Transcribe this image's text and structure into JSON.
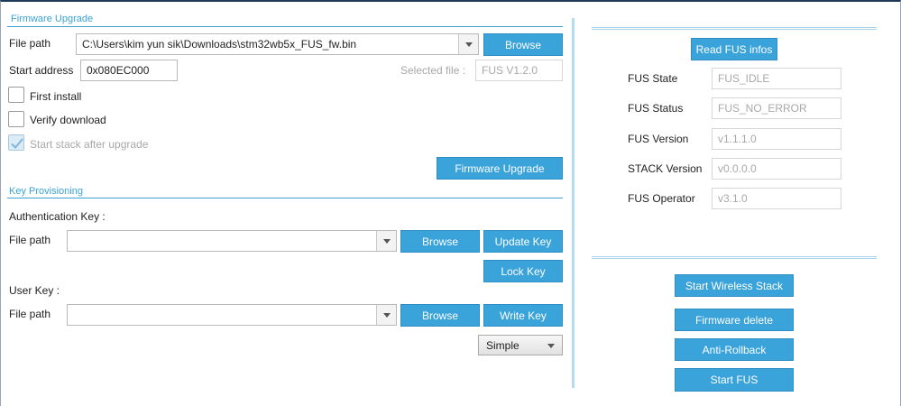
{
  "firmware_upgrade": {
    "section_title": "Firmware Upgrade",
    "file_path_label": "File path",
    "file_path_value": "C:\\Users\\kim yun sik\\Downloads\\stm32wb5x_FUS_fw.bin",
    "browse_label": "Browse",
    "start_address_label": "Start address",
    "start_address_value": "0x080EC000",
    "selected_file_label": "Selected file :",
    "selected_file_value": "FUS V1.2.0",
    "first_install_label": "First install",
    "first_install_checked": false,
    "verify_download_label": "Verify download",
    "verify_download_checked": false,
    "start_stack_label": "Start stack after upgrade",
    "start_stack_checked": true,
    "upgrade_button_label": "Firmware Upgrade"
  },
  "key_provisioning": {
    "section_title": "Key Provisioning",
    "auth_key_label": "Authentication Key :",
    "auth_file_path_label": "File path",
    "auth_file_path_value": "",
    "auth_browse_label": "Browse",
    "update_key_label": "Update Key",
    "lock_key_label": "Lock Key",
    "user_key_label": "User Key :",
    "user_file_path_label": "File path",
    "user_file_path_value": "",
    "user_browse_label": "Browse",
    "write_key_label": "Write Key",
    "key_type_selected": "Simple"
  },
  "fus_info": {
    "read_button_label": "Read FUS infos",
    "rows": [
      {
        "label": "FUS State",
        "value": "FUS_IDLE"
      },
      {
        "label": "FUS Status",
        "value": "FUS_NO_ERROR"
      },
      {
        "label": "FUS Version",
        "value": "v1.1.1.0"
      },
      {
        "label": "STACK Version",
        "value": "v0.0.0.0"
      },
      {
        "label": "FUS Operator",
        "value": "v3.1.0"
      }
    ]
  },
  "actions": {
    "start_wireless_stack_label": "Start Wireless Stack",
    "firmware_delete_label": "Firmware delete",
    "anti_rollback_label": "Anti-Rollback",
    "start_fus_label": "Start FUS"
  },
  "colors": {
    "accent": "#3aa3d9",
    "section_title": "#3aa3d4",
    "disabled_text": "#a8a8a8"
  }
}
